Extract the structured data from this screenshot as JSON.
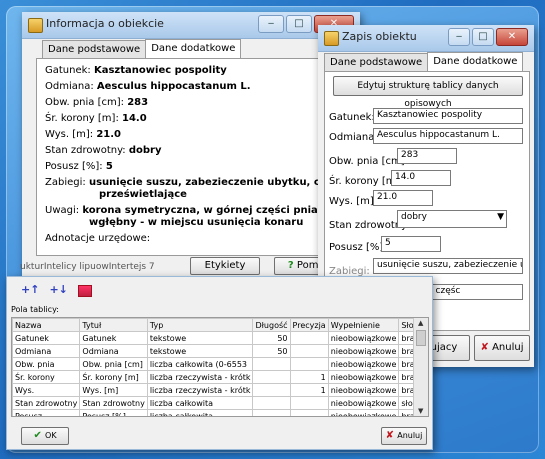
{
  "win1": {
    "title": "Informacja o obiekcie",
    "tabs": [
      "Dane podstawowe",
      "Dane dodatkowe"
    ],
    "rows": [
      {
        "label": "Gatunek:",
        "value": "Kasztanowiec pospolity"
      },
      {
        "label": "Odmiana:",
        "value": "Aesculus hippocastanum L."
      },
      {
        "label": "Obw. pnia [cm]:",
        "value": "283"
      },
      {
        "label": "Śr. korony [m]:",
        "value": "14.0"
      },
      {
        "label": "Wys. [m]:",
        "value": "21.0"
      },
      {
        "label": "Stan zdrowotny:",
        "value": "dobry"
      },
      {
        "label": "Posusz [%]:",
        "value": "5"
      }
    ],
    "zabiegi_label": "Zabiegi:",
    "zabiegi_value_1": "usunięcie suszu, zabezieczenie ubytku, cięcia",
    "zabiegi_value_2": "prześwietlające",
    "uwagi_label": "Uwagi:",
    "uwagi_value_1": "korona symetryczna, w górnej części pnia ubytek",
    "uwagi_value_2": "wgłębny - w miejscu usunięcia konaru",
    "adnotacje_label": "Adnotacje urzędowe:",
    "bottom_text": "ukturIntelicy lipuowIntertejs 7",
    "etykiety": "Etykiety",
    "pomoc": "Pomoc"
  },
  "win2": {
    "title": "Zapis obiektu",
    "tabs": [
      "Dane podstawowe",
      "Dane dodatkowe"
    ],
    "edit_button": "Edytuj strukturę tablicy danych opisowych",
    "fields": {
      "gatunek_label": "Gatunek:",
      "gatunek_value": "Kasztanowiec pospolity",
      "odmiana_label": "Odmiana:",
      "odmiana_value": "Aesculus hippocastanum L.",
      "obw_label": "Obw. pnia [cm]:",
      "obw_value": "283",
      "sr_label": "Śr. korony [m]:",
      "sr_value": "14.0",
      "wys_label": "Wys. [m]:",
      "wys_value": "21.0",
      "stan_label": "Stan zdrowotny:",
      "stan_value": "dobry",
      "posusz_label": "Posusz [%]:",
      "posusz_value": "5",
      "zabiegi_label": "Zabiegi:",
      "zabiegi_value": "usunięcie suszu, zabezieczenie ubył",
      "uwagi_value": "na, w górnej częśc"
    },
    "ok_partial": "ujacy",
    "anuluj": "Anuluj"
  },
  "win3": {
    "pola_label": "Pola tablicy:",
    "columns": [
      "Nazwa",
      "Tytuł",
      "Typ",
      "Długość",
      "Precyzja",
      "Wypełnienie",
      "Słownik"
    ],
    "rows": [
      [
        "Gatunek",
        "Gatunek",
        "tekstowe",
        "50",
        "",
        "nieobowiązkowe",
        "brak"
      ],
      [
        "Odmiana",
        "Odmiana",
        "tekstowe",
        "50",
        "",
        "nieobowiązkowe",
        "brak"
      ],
      [
        "Obw. pnia",
        "Obw. pnia [cm]",
        "liczba całkowita (0-6553",
        "",
        "",
        "nieobowiązkowe",
        "brak"
      ],
      [
        "Śr. korony",
        "Śr. korony [m]",
        "liczba rzeczywista - krótk",
        "",
        "1",
        "nieobowiązkowe",
        "brak"
      ],
      [
        "Wys.",
        "Wys. [m]",
        "liczba rzeczywista - krótk",
        "",
        "1",
        "nieobowiązkowe",
        "brak"
      ],
      [
        "Stan zdrowotny",
        "Stan zdrowotny",
        "liczba całkowita",
        "",
        "",
        "nieobowiązkowe",
        "słownik"
      ],
      [
        "Posusz",
        "Posusz [%]",
        "liczba całkowita",
        "",
        "",
        "nieobowiązkowe",
        "brak"
      ]
    ],
    "ok": "OK",
    "anuluj": "Anuluj"
  }
}
